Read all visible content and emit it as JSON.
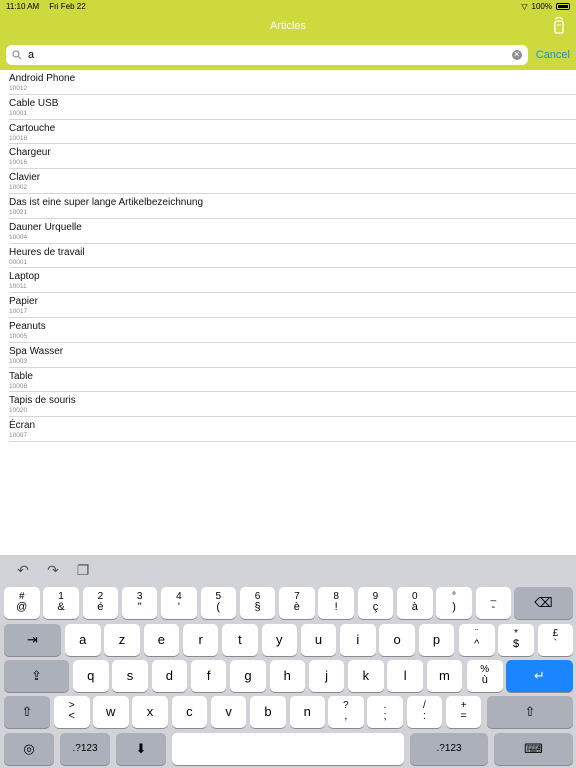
{
  "status_bar": {
    "time": "11:10 AM",
    "date": "Fri Feb 22",
    "battery": "100%"
  },
  "nav": {
    "title": "Articles"
  },
  "search": {
    "value": "a",
    "cancel_label": "Cancel"
  },
  "articles": [
    {
      "name": "Android Phone",
      "code": "10012"
    },
    {
      "name": "Cable USB",
      "code": "10001"
    },
    {
      "name": "Cartouche",
      "code": "10018"
    },
    {
      "name": "Chargeur",
      "code": "10016"
    },
    {
      "name": "Clavier",
      "code": "10002"
    },
    {
      "name": "Das ist eine super lange Artikelbezeichnung",
      "code": "10021"
    },
    {
      "name": "Dauner Urquelle",
      "code": "10004"
    },
    {
      "name": "Heures de travail",
      "code": "00001"
    },
    {
      "name": "Laptop",
      "code": "10011"
    },
    {
      "name": "Papier",
      "code": "10017"
    },
    {
      "name": "Peanuts",
      "code": "10005"
    },
    {
      "name": "Spa Wasser",
      "code": "10003"
    },
    {
      "name": "Table",
      "code": "10008"
    },
    {
      "name": "Tapis de souris",
      "code": "10020"
    },
    {
      "name": "Écran",
      "code": "10007"
    }
  ],
  "keyboard": {
    "row1": [
      {
        "top": "#",
        "bot": "@"
      },
      {
        "top": "1",
        "bot": "&"
      },
      {
        "top": "2",
        "bot": "é"
      },
      {
        "top": "3",
        "bot": "\""
      },
      {
        "top": "4",
        "bot": "'"
      },
      {
        "top": "5",
        "bot": "("
      },
      {
        "top": "6",
        "bot": "§"
      },
      {
        "top": "7",
        "bot": "è"
      },
      {
        "top": "8",
        "bot": "!"
      },
      {
        "top": "9",
        "bot": "ç"
      },
      {
        "top": "0",
        "bot": "à"
      },
      {
        "top": "°",
        "bot": ")"
      },
      {
        "top": "_",
        "bot": "-"
      }
    ],
    "row2": [
      "a",
      "z",
      "e",
      "r",
      "t",
      "y",
      "u",
      "i",
      "o",
      "p"
    ],
    "row2_extra": [
      {
        "top": "¨",
        "bot": "^"
      },
      {
        "top": "*",
        "bot": "$"
      },
      {
        "top": "£",
        "bot": "`"
      }
    ],
    "row3": [
      "q",
      "s",
      "d",
      "f",
      "g",
      "h",
      "j",
      "k",
      "l",
      "m"
    ],
    "row3_extra": {
      "top": "%",
      "bot": "ù"
    },
    "row4": [
      "w",
      "x",
      "c",
      "v",
      "b",
      "n"
    ],
    "row4_first": {
      "top": ">",
      "bot": "<"
    },
    "row4_extra": [
      {
        "top": "?",
        "bot": ","
      },
      {
        "top": ".",
        "bot": ";"
      },
      {
        "top": "/",
        "bot": ":"
      },
      {
        "top": "+",
        "bot": "="
      }
    ],
    "numbers_label": ".?123"
  }
}
